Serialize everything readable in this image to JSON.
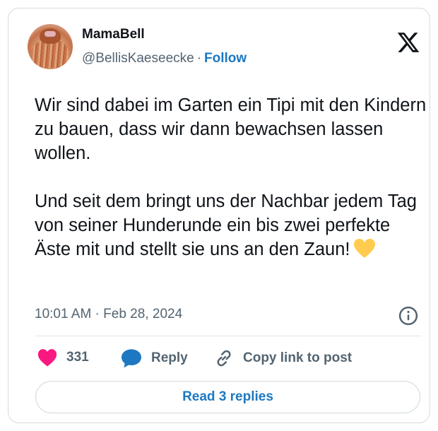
{
  "author": {
    "display_name": "MamaBell",
    "handle": "@BellisKaeseecke",
    "separator": "·",
    "follow_label": "Follow"
  },
  "tweet": {
    "paragraphs": [
      "Wir sind dabei im Garten ein Tipi mit den Kindern zu bauen, dass wir dann bewachsen lassen wollen.",
      "Und seit dem bringt uns der Nachbar jedem Tag von seiner Hunderunde ein bis zwei perfekte Äste mit und stellt sie uns an den Zaun!"
    ],
    "emoji": "yellow-heart",
    "timestamp": "10:01 AM · Feb 28, 2024"
  },
  "actions": {
    "likes_count": "331",
    "reply_label": "Reply",
    "copy_label": "Copy link to post"
  },
  "read_replies_label": "Read 3 replies",
  "icons": [
    "x-logo",
    "info-icon",
    "heart-icon",
    "reply-bubble-icon",
    "link-icon",
    "yellow-heart-emoji"
  ],
  "colors": {
    "accent": "#1d78c1",
    "like_pink": "#f91880",
    "reply_blue": "#1d78c1",
    "text_secondary": "#536471",
    "emoji_yellow": "#ffcc4d"
  }
}
